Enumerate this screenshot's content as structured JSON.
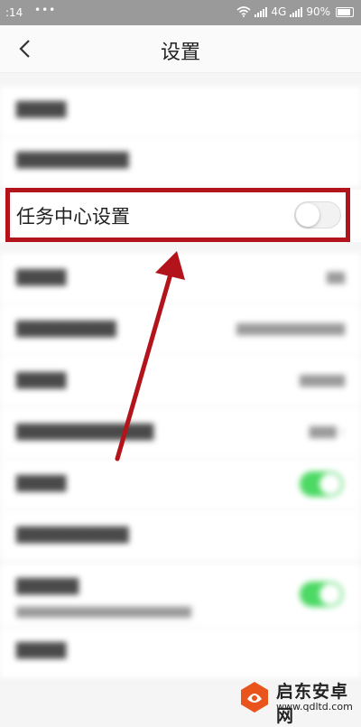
{
  "status_bar": {
    "time": ":14",
    "dots": "•••",
    "network": "4G",
    "battery": "90%",
    "icons": [
      "wifi-icon",
      "signal-icon",
      "battery-icon"
    ]
  },
  "header": {
    "title": "设置",
    "back_icon": "chevron-left-icon"
  },
  "task_center": {
    "label": "任务中心设置",
    "toggle_on": false
  },
  "blurred_toggles_on": [
    true,
    true
  ],
  "annotation": {
    "box_color": "#b3141b",
    "arrow_color": "#b3141b",
    "toggle_on_color": "#4cd964"
  },
  "watermark": {
    "title": "启东安卓网",
    "url": "www.qdltd.com",
    "logo_color": "#e8541c"
  }
}
